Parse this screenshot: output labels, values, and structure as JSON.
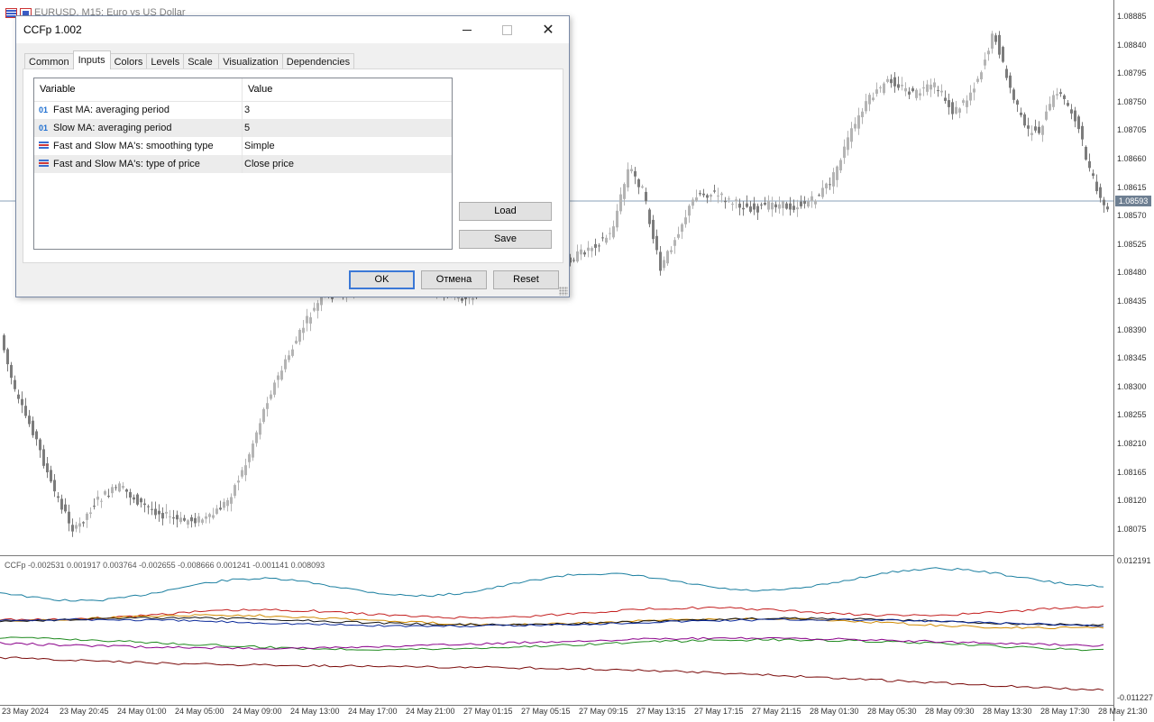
{
  "chart": {
    "title": "EURUSD, M15:  Euro vs US Dollar",
    "price_axis": [
      "1.08885",
      "1.08840",
      "1.08795",
      "1.08750",
      "1.08705",
      "1.08660",
      "1.08615",
      "1.08570",
      "1.08525",
      "1.08480",
      "1.08435",
      "1.08390",
      "1.08345",
      "1.08300",
      "1.08255",
      "1.08210",
      "1.08165",
      "1.08120",
      "1.08075"
    ],
    "current_price": "1.08593",
    "indicator_label": "CCFp -0.002531 0.001917 0.003764 -0.002655 -0.008666 0.001241 -0.001141 0.008093",
    "indicator_axis": [
      "0.012191",
      "-0.011227"
    ],
    "time_axis": [
      "23 May 2024",
      "23 May 20:45",
      "24 May 01:00",
      "24 May 05:00",
      "24 May 09:00",
      "24 May 13:00",
      "24 May 17:00",
      "24 May 21:00",
      "27 May 01:15",
      "27 May 05:15",
      "27 May 09:15",
      "27 May 13:15",
      "27 May 17:15",
      "27 May 21:15",
      "28 May 01:30",
      "28 May 05:30",
      "28 May 09:30",
      "28 May 13:30",
      "28 May 17:30",
      "28 May 21:30"
    ],
    "line_colors": [
      "#1b7fa0",
      "#c42020",
      "#d08a00",
      "#111111",
      "#0b2a9a",
      "#1f8a1f",
      "#8a008a",
      "#7a0a0a"
    ],
    "candle_colors": {
      "bull": "#b4b4b4",
      "bear": "#7c7c7c"
    }
  },
  "dialog": {
    "title": "CCFp 1.002",
    "tabs": [
      {
        "label": "Common"
      },
      {
        "label": "Inputs"
      },
      {
        "label": "Colors"
      },
      {
        "label": "Levels"
      },
      {
        "label": "Scale"
      },
      {
        "label": "Visualization"
      },
      {
        "label": "Dependencies"
      }
    ],
    "active_tab": "Inputs",
    "grid": {
      "headers": {
        "variable": "Variable",
        "value": "Value"
      },
      "rows": [
        {
          "icon": "int-icon",
          "icon_text": "01",
          "variable": "Fast MA: averaging period",
          "value": "3"
        },
        {
          "icon": "int-icon",
          "icon_text": "01",
          "variable": "Slow MA: averaging period",
          "value": "5"
        },
        {
          "icon": "enum-icon",
          "icon_text": "",
          "variable": "Fast and Slow MA's: smoothing type",
          "value": "Simple"
        },
        {
          "icon": "enum-icon",
          "icon_text": "",
          "variable": "Fast and Slow MA's: type of price",
          "value": "Close price"
        }
      ]
    },
    "buttons": {
      "load": "Load",
      "save": "Save",
      "ok": "OK",
      "cancel": "Отмена",
      "reset": "Reset"
    }
  }
}
